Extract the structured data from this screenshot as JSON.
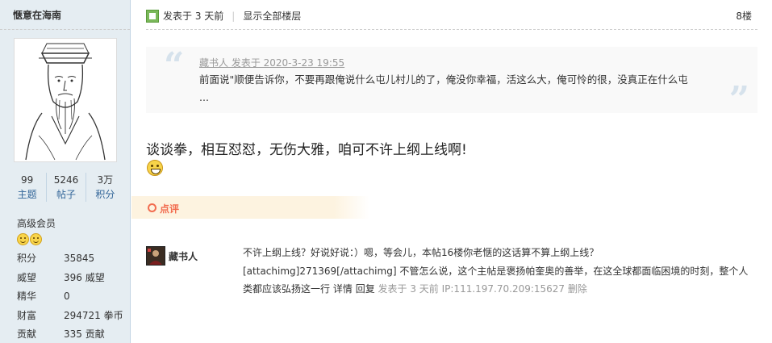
{
  "profile": {
    "username": "惬意在海南",
    "stats": [
      {
        "value": "99",
        "label": "主题"
      },
      {
        "value": "5246",
        "label": "帖子"
      },
      {
        "value": "3万",
        "label": "积分"
      }
    ],
    "member_level": "高级会员",
    "info": [
      {
        "key": "积分",
        "value": "35845"
      },
      {
        "key": "威望",
        "value": "396 威望"
      },
      {
        "key": "精华",
        "value": "0"
      },
      {
        "key": "财富",
        "value": "294721 拳币"
      },
      {
        "key": "贡献",
        "value": "335 贡献"
      }
    ]
  },
  "post": {
    "posted": "发表于 3 天前",
    "show_all": "显示全部楼层",
    "floor": "8楼",
    "quote": {
      "meta": "藏书人 发表于 2020-3-23 19:55",
      "body": "前面说\"顺便告诉你，不要再跟俺说什么屯儿村儿的了，俺没你幸福，活这么大，俺可怜的很，没真正在什么屯 ..."
    },
    "body": "谈谈拳，相互怼怼，无伤大雅，咱可不许上纲上线啊!",
    "comment_tab": "点评",
    "comment": {
      "author": "藏书人",
      "text": "不许上纲上线？好说好说：）嗯，等会儿，本帖16楼你老惬的这话算不算上纲上线？ [attachimg]271369[/attachimg] 不管怎么说，这个主帖是褒扬帕奎奥的善举，在这全球都面临困境的时刻，整个人类都应该弘扬这一行",
      "detail_link": "详情",
      "reply_link": "回复",
      "meta": "发表于 3 天前 IP:111.197.70.209:15627",
      "delete_link": "删除"
    }
  },
  "colors": {
    "sidebar_bg": "#e5edf2",
    "link_blue": "#336699",
    "accent_orange": "#f26c4f",
    "quote_bg": "#f9f9f9"
  }
}
